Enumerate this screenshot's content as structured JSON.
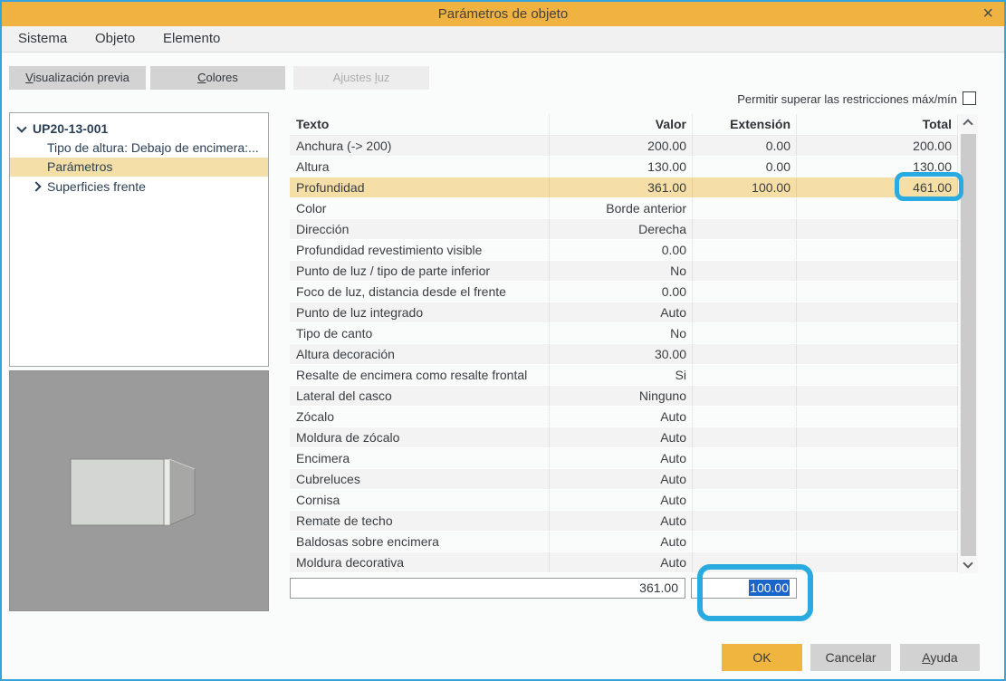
{
  "window": {
    "title": "Parámetros de objeto",
    "close_icon": "×"
  },
  "menu": [
    "Sistema",
    "Objeto",
    "Elemento"
  ],
  "tabs": [
    {
      "pre": "",
      "u": "V",
      "post": "isualización previa",
      "enabled": true
    },
    {
      "pre": "",
      "u": "C",
      "post": "olores",
      "enabled": true
    },
    {
      "pre": "Ajustes ",
      "u": "l",
      "post": "uz",
      "enabled": false
    }
  ],
  "options": {
    "allow_exceed_label": "Permitir superar las restricciones máx/mín",
    "checked": false
  },
  "tree": {
    "root": "UP20-13-001",
    "children": [
      {
        "label": "Tipo de altura: Debajo de encimera:..."
      },
      {
        "label": "Parámetros",
        "selected": true
      },
      {
        "label": "Superficies frente"
      }
    ]
  },
  "table": {
    "headers": {
      "texto": "Texto",
      "valor": "Valor",
      "extension": "Extensión",
      "total": "Total"
    },
    "rows": [
      {
        "texto": "Anchura (-> 200)",
        "valor": "200.00",
        "extension": "0.00",
        "total": "200.00"
      },
      {
        "texto": "Altura",
        "valor": "130.00",
        "extension": "0.00",
        "total": "130.00"
      },
      {
        "texto": "Profundidad",
        "valor": "361.00",
        "extension": "100.00",
        "total": "461.00",
        "highlighted": true
      },
      {
        "texto": "Color",
        "valor": "Borde anterior"
      },
      {
        "texto": "Dirección",
        "valor": "Derecha"
      },
      {
        "texto": "Profundidad revestimiento visible",
        "valor": "0.00"
      },
      {
        "texto": "Punto de luz / tipo de parte inferior",
        "valor": "No"
      },
      {
        "texto": "Foco de luz, distancia desde el frente",
        "valor": "0.00"
      },
      {
        "texto": "Punto de luz integrado",
        "valor": "Auto"
      },
      {
        "texto": "Tipo de canto",
        "valor": "No"
      },
      {
        "texto": "Altura decoración",
        "valor": "30.00"
      },
      {
        "texto": "Resalte de encimera como resalte frontal",
        "valor": "Si"
      },
      {
        "texto": "Lateral del casco",
        "valor": "Ninguno"
      },
      {
        "texto": "Zócalo",
        "valor": "Auto"
      },
      {
        "texto": "Moldura de zócalo",
        "valor": "Auto"
      },
      {
        "texto": "Encimera",
        "valor": "Auto"
      },
      {
        "texto": "Cubreluces",
        "valor": "Auto"
      },
      {
        "texto": "Cornisa",
        "valor": "Auto"
      },
      {
        "texto": "Remate de techo",
        "valor": "Auto"
      },
      {
        "texto": "Baldosas sobre encimera",
        "valor": "Auto"
      },
      {
        "texto": "Moldura decorativa",
        "valor": "Auto"
      }
    ]
  },
  "edit_fields": {
    "valor": "361.00",
    "extension": "100.00",
    "extension_selected": true
  },
  "buttons": {
    "ok": "OK",
    "cancel": "Cancelar",
    "help_pre": "",
    "help_u": "A",
    "help_post": "yuda"
  },
  "colors": {
    "titlebar": "#F0B341",
    "ok_button": "#F0B53E",
    "row_highlight": "#F6DFA6",
    "tree_selection": "#F5DFA8",
    "annotation": "#29ABE2",
    "text_selection": "#1B64C8",
    "dialog_border": "#35A3DC"
  }
}
